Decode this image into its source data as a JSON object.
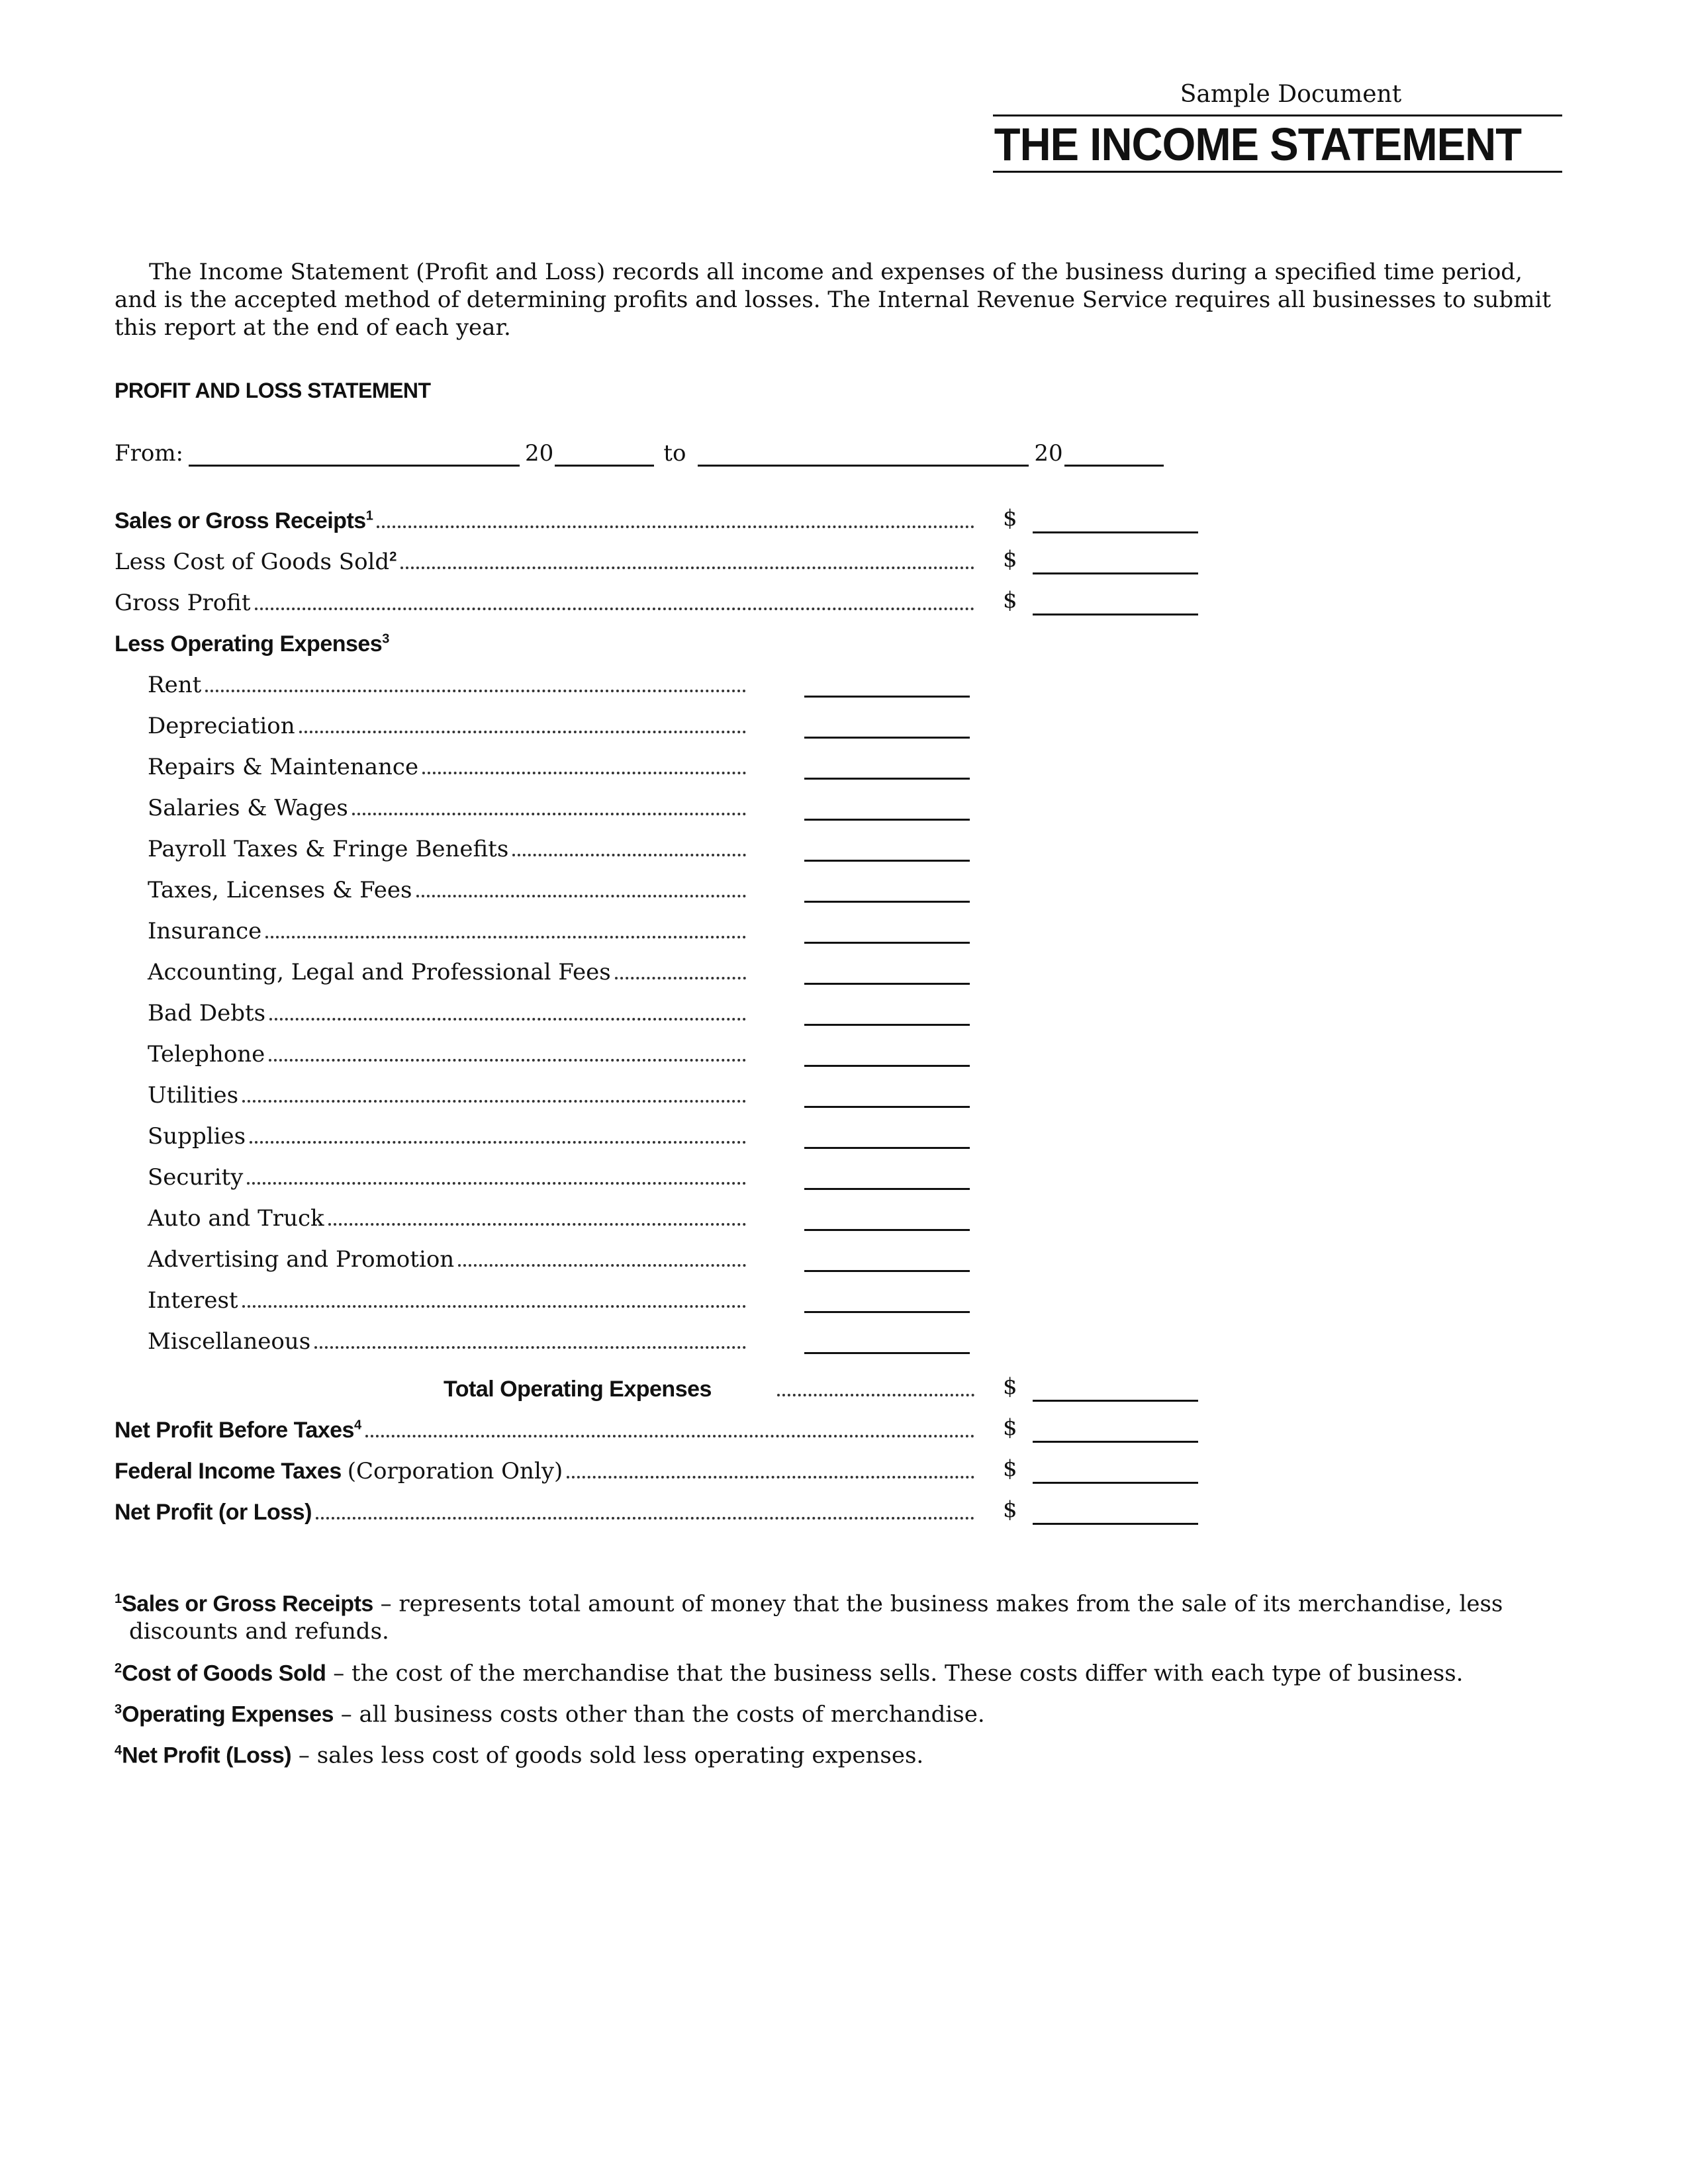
{
  "header": {
    "subtitle": "Sample Document",
    "title": "THE INCOME STATEMENT"
  },
  "intro": "The Income Statement (Profit and Loss) records all income and expenses of the business during a specified time period, and is the accepted method of determining profits and losses. The Internal Revenue Service requires all businesses to submit this report at the end of each year.",
  "statement": {
    "heading": "PROFIT AND LOSS STATEMENT",
    "from_row": {
      "from_label": "From:",
      "year_prefix_1": "20",
      "to_label": "to",
      "year_prefix_2": "20",
      "from_date_value": "",
      "from_year_value": "",
      "to_date_value": "",
      "to_year_value": ""
    },
    "currency_symbol": "$",
    "sales": {
      "label": "Sales or Gross Receipts",
      "footnote": "1",
      "value": ""
    },
    "cogs": {
      "label": "Less Cost of Goods Sold",
      "footnote": "2",
      "value": ""
    },
    "gross_profit": {
      "label": "Gross Profit",
      "value": ""
    },
    "opex_heading": {
      "label": "Less Operating Expenses",
      "footnote": "3"
    },
    "expenses": [
      {
        "label": "Rent",
        "value": ""
      },
      {
        "label": "Depreciation",
        "value": ""
      },
      {
        "label": "Repairs & Maintenance",
        "value": ""
      },
      {
        "label": "Salaries & Wages",
        "value": ""
      },
      {
        "label": "Payroll Taxes & Fringe Benefits",
        "value": ""
      },
      {
        "label": "Taxes, Licenses & Fees",
        "value": ""
      },
      {
        "label": "Insurance",
        "value": ""
      },
      {
        "label": "Accounting, Legal and Professional Fees",
        "value": ""
      },
      {
        "label": "Bad Debts",
        "value": ""
      },
      {
        "label": "Telephone",
        "value": ""
      },
      {
        "label": "Utilities",
        "value": ""
      },
      {
        "label": "Supplies",
        "value": ""
      },
      {
        "label": "Security",
        "value": ""
      },
      {
        "label": "Auto and Truck",
        "value": ""
      },
      {
        "label": "Advertising and Promotion",
        "value": ""
      },
      {
        "label": "Interest",
        "value": ""
      },
      {
        "label": "Miscellaneous",
        "value": ""
      }
    ],
    "total_opex": {
      "label": "Total Operating Expenses",
      "value": ""
    },
    "net_before_tax": {
      "label": "Net Profit Before Taxes",
      "footnote": "4",
      "value": ""
    },
    "federal_tax": {
      "label": "Federal Income Taxes",
      "qualifier": "(Corporation Only)",
      "value": ""
    },
    "net_profit": {
      "label": "Net Profit (or Loss)",
      "value": ""
    }
  },
  "footnotes": [
    {
      "num": "1",
      "term": "Sales or Gross Receipts",
      "text": " – represents total amount of money that the business makes from the sale of its merchandise, less",
      "cont": "discounts and refunds."
    },
    {
      "num": "2",
      "term": "Cost of Goods Sold",
      "text": " – the cost of the merchandise that the business sells. These costs differ with each type of business."
    },
    {
      "num": "3",
      "term": "Operating Expenses",
      "text": " – all business costs other than the costs of merchandise."
    },
    {
      "num": "4",
      "term": "Net Profit (Loss)",
      "text": " – sales less cost of goods sold less operating expenses."
    }
  ]
}
